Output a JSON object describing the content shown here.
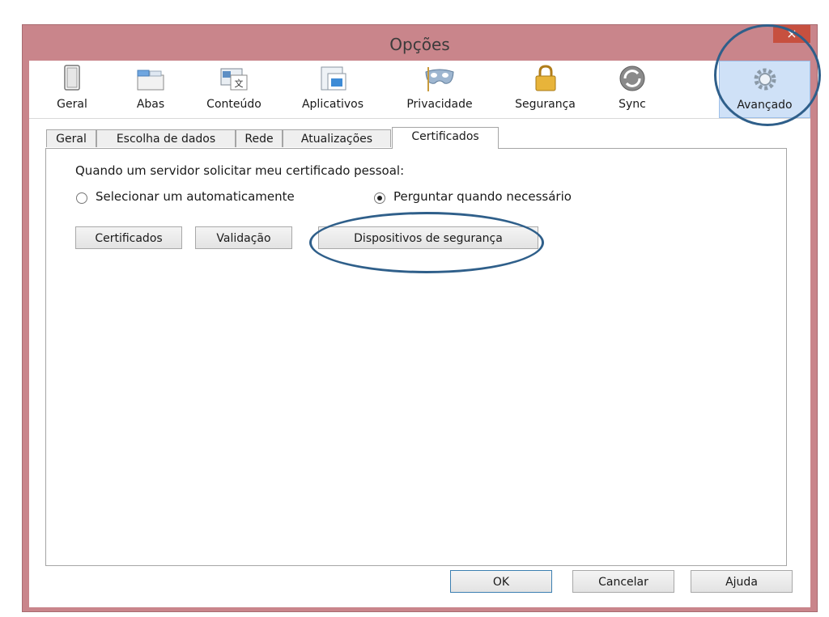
{
  "window": {
    "title": "Opções",
    "close_label": "×"
  },
  "toolbar": {
    "items": [
      {
        "label": "Geral",
        "icon": "switch-icon"
      },
      {
        "label": "Abas",
        "icon": "tabs-icon"
      },
      {
        "label": "Conteúdo",
        "icon": "content-icon"
      },
      {
        "label": "Aplicativos",
        "icon": "applications-icon"
      },
      {
        "label": "Privacidade",
        "icon": "mask-icon"
      },
      {
        "label": "Segurança",
        "icon": "lock-icon"
      },
      {
        "label": "Sync",
        "icon": "sync-icon"
      },
      {
        "label": "Avançado",
        "icon": "gear-icon",
        "active": true
      }
    ]
  },
  "subtabs": {
    "items": [
      {
        "label": "Geral"
      },
      {
        "label": "Escolha de dados"
      },
      {
        "label": "Rede"
      },
      {
        "label": "Atualizações"
      },
      {
        "label": "Certificados",
        "active": true
      }
    ]
  },
  "certificates": {
    "prompt": "Quando um servidor solicitar meu certificado pessoal:",
    "option_auto": "Selecionar um automaticamente",
    "option_ask": "Perguntar quando necessário",
    "selected_option": "option_ask",
    "buttons": {
      "certificates": "Certificados",
      "validation": "Validação",
      "security_devices": "Dispositivos de segurança"
    }
  },
  "footer": {
    "ok": "OK",
    "cancel": "Cancelar",
    "help": "Ajuda"
  },
  "colors": {
    "frame": "#c9858b",
    "highlight_circle": "#2f5f8a",
    "active_toolbar": "#cfe1f7"
  }
}
